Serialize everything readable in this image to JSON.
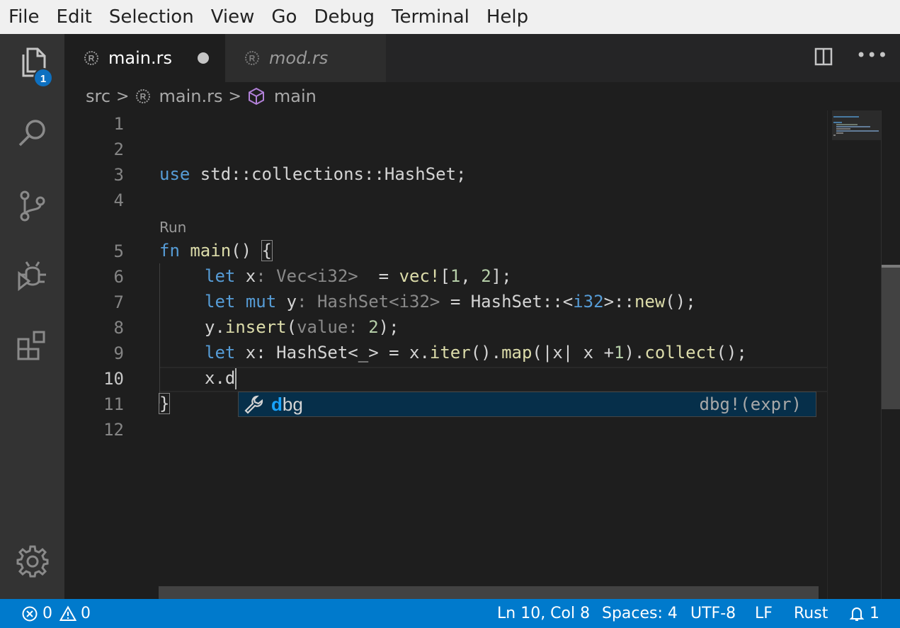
{
  "menu": [
    "File",
    "Edit",
    "Selection",
    "View",
    "Go",
    "Debug",
    "Terminal",
    "Help"
  ],
  "activity": {
    "explorer_badge": "1",
    "icons": [
      "files-icon",
      "search-icon",
      "source-control-icon",
      "debug-icon",
      "extensions-icon",
      "settings-gear-icon"
    ]
  },
  "tabs": [
    {
      "label": "main.rs",
      "active": true,
      "dirty": true
    },
    {
      "label": "mod.rs",
      "active": false,
      "preview": true
    }
  ],
  "breadcrumb": {
    "folder": "src",
    "file": "main.rs",
    "symbol": "main"
  },
  "editor": {
    "line_numbers": [
      "1",
      "2",
      "3",
      "4",
      "5",
      "6",
      "7",
      "8",
      "9",
      "10",
      "11",
      "12"
    ],
    "current_line": "10",
    "codelens": "Run",
    "lines": {
      "l3_kw": "use",
      "l3_rest": " std::collections::HashSet;",
      "l5_kw": "fn",
      "l5_fn": "main",
      "l5_parens": "() ",
      "l5_brace": "{",
      "l6_kw": "let",
      "l6_var": " x",
      "l6_hint": ": Vec<i32> ",
      "l6_eq": " = ",
      "l6_macro": "vec!",
      "l6_open": "[",
      "l6_n1": "1",
      "l6_comma": ", ",
      "l6_n2": "2",
      "l6_close": "];",
      "l7_kw1": "let",
      "l7_kw2": "mut",
      "l7_var": " y",
      "l7_hint": ": HashSet<i32>",
      "l7_eq": " = HashSet::<",
      "l7_ty": "i32",
      "l7_mid": ">::",
      "l7_fn": "new",
      "l7_end": "();",
      "l8_var": "y.",
      "l8_fn": "insert",
      "l8_open": "(",
      "l8_hint": "value:",
      "l8_sp": " ",
      "l8_num": "2",
      "l8_end": ");",
      "l9_kw": "let",
      "l9_a": " x: HashSet<_> = x.",
      "l9_iter": "iter",
      "l9_b": "().",
      "l9_map": "map",
      "l9_c": "(|x| x +",
      "l9_num": "1",
      "l9_d": ").",
      "l9_collect": "collect",
      "l9_e": "();",
      "l10": "x.d",
      "l11": "}"
    }
  },
  "suggest": {
    "match": "d",
    "rest": "bg",
    "detail": "dbg!(expr)",
    "icon": "wrench-icon"
  },
  "status": {
    "errors": "0",
    "warnings": "0",
    "position": "Ln 10, Col 8",
    "spaces": "Spaces: 4",
    "encoding": "UTF-8",
    "eol": "LF",
    "language": "Rust",
    "notifications": "1"
  },
  "colors": {
    "statusbar": "#007acc",
    "keyword": "#569cd6",
    "function": "#dcdcaa",
    "number": "#b5cea8",
    "suggest_bg": "#062f4a",
    "match": "#18a3ff"
  }
}
